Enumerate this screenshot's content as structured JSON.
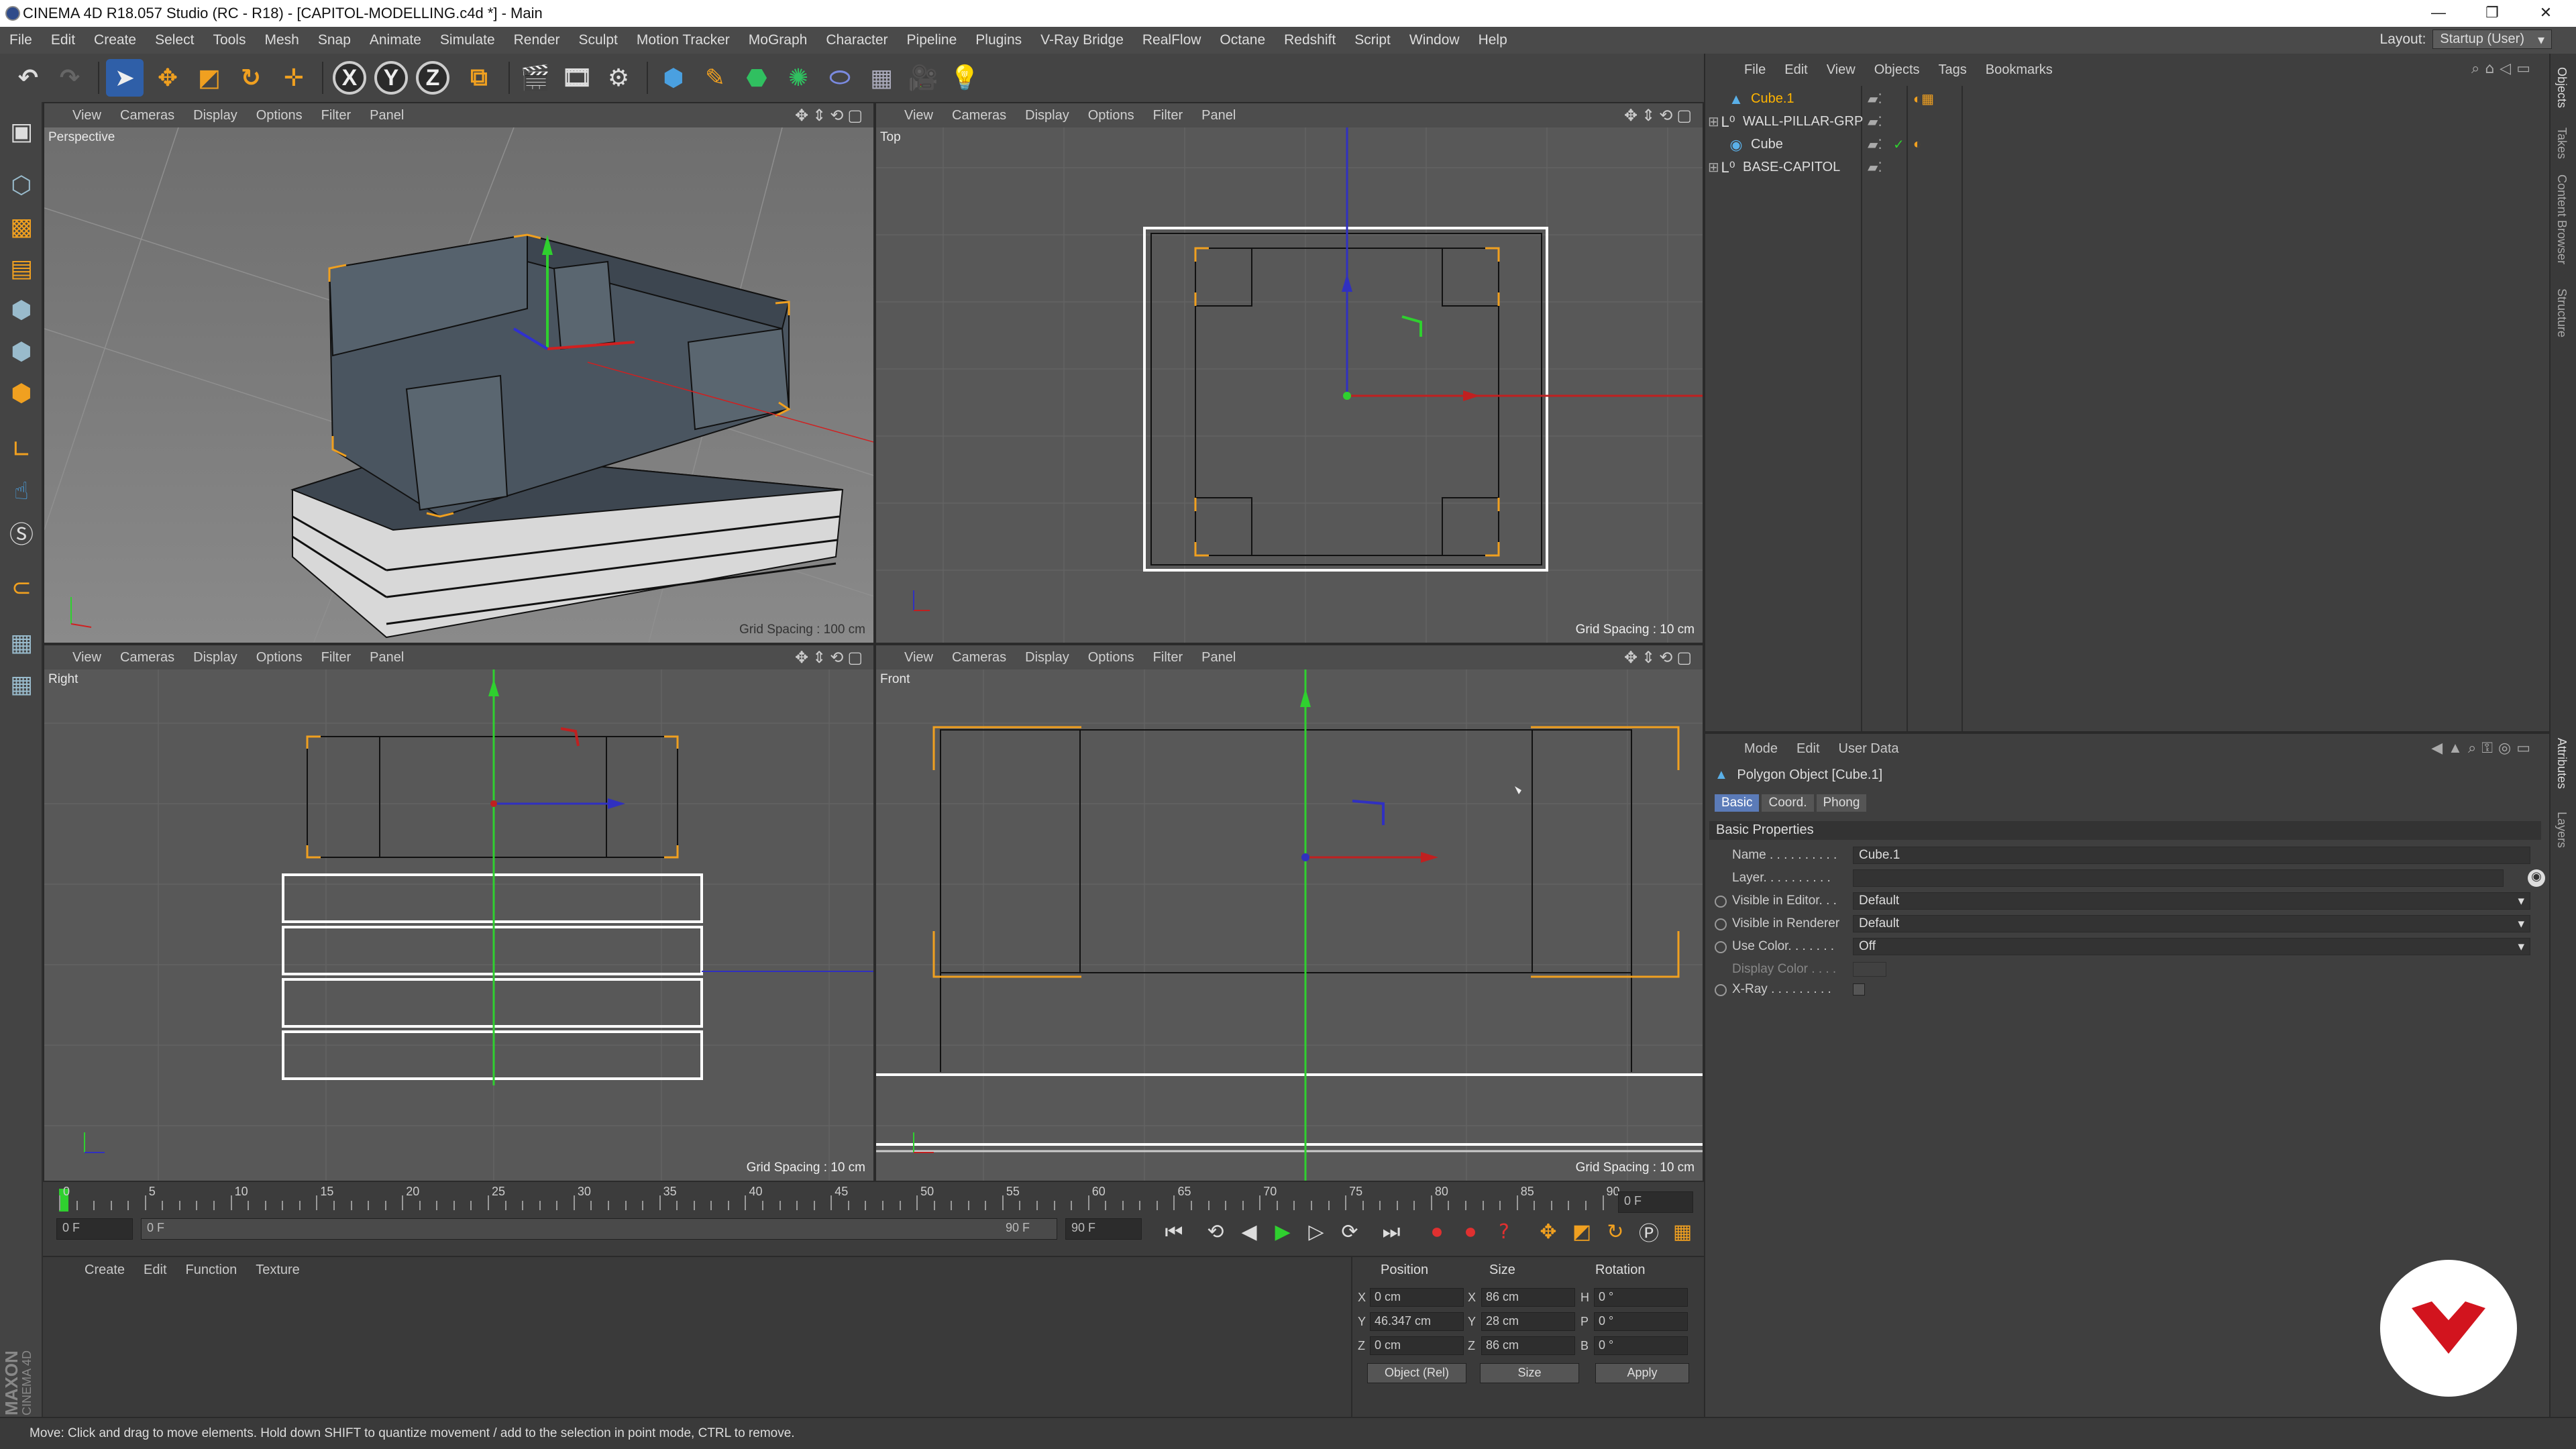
{
  "titlebar": {
    "title": "CINEMA 4D R18.057 Studio (RC - R18) - [CAPITOL-MODELLING.c4d *] - Main",
    "min": "—",
    "restore": "❐",
    "close": "✕"
  },
  "menubar": {
    "items": [
      "File",
      "Edit",
      "Create",
      "Select",
      "Tools",
      "Mesh",
      "Snap",
      "Animate",
      "Simulate",
      "Render",
      "Sculpt",
      "Motion Tracker",
      "MoGraph",
      "Character",
      "Pipeline",
      "Plugins",
      "V-Ray Bridge",
      "RealFlow",
      "Octane",
      "Redshift",
      "Script",
      "Window",
      "Help"
    ],
    "layout_label": "Layout:",
    "layout_value": "Startup (User)"
  },
  "toolbar": {
    "axis_x": "X",
    "axis_y": "Y",
    "axis_z": "Z"
  },
  "viewports": {
    "menu": [
      "View",
      "Cameras",
      "Display",
      "Options",
      "Filter",
      "Panel"
    ],
    "perspective": {
      "name": "Perspective",
      "grid": "Grid Spacing : 100 cm"
    },
    "top": {
      "name": "Top",
      "grid": "Grid Spacing : 10 cm"
    },
    "right": {
      "name": "Right",
      "grid": "Grid Spacing : 10 cm"
    },
    "front": {
      "name": "Front",
      "grid": "Grid Spacing : 10 cm"
    }
  },
  "timeline": {
    "ruler": [
      "0",
      "5",
      "10",
      "15",
      "20",
      "25",
      "30",
      "35",
      "40",
      "45",
      "50",
      "55",
      "60",
      "65",
      "70",
      "75",
      "80",
      "85",
      "90"
    ],
    "current_frame_right": "0 F",
    "start_frame": "0 F",
    "range_start": "0 F",
    "range_end": "90 F",
    "end_frame": "90 F"
  },
  "material_manager": {
    "menu": [
      "Create",
      "Edit",
      "Function",
      "Texture"
    ]
  },
  "coordinates": {
    "headers": [
      "Position",
      "Size",
      "Rotation"
    ],
    "rows": [
      {
        "axis": "X",
        "pos": "0 cm",
        "saxis": "X",
        "size": "86 cm",
        "raxis": "H",
        "rot": "0 °"
      },
      {
        "axis": "Y",
        "pos": "46.347 cm",
        "saxis": "Y",
        "size": "28 cm",
        "raxis": "P",
        "rot": "0 °"
      },
      {
        "axis": "Z",
        "pos": "0 cm",
        "saxis": "Z",
        "size": "86 cm",
        "raxis": "B",
        "rot": "0 °"
      }
    ],
    "mode": "Object (Rel)",
    "size_mode": "Size",
    "apply": "Apply"
  },
  "maxon": {
    "line1": "MAXON",
    "line2": "CINEMA 4D"
  },
  "object_manager": {
    "menu": [
      "File",
      "Edit",
      "View",
      "Objects",
      "Tags",
      "Bookmarks"
    ],
    "objects": [
      {
        "name": "Cube.1",
        "selected": true
      },
      {
        "name": "WALL-PILLAR-GRP",
        "selected": false
      },
      {
        "name": "Cube",
        "selected": false
      },
      {
        "name": "BASE-CAPITOL",
        "selected": false
      }
    ]
  },
  "attributes": {
    "menu": [
      "Mode",
      "Edit",
      "User Data"
    ],
    "object_title": "Polygon Object [Cube.1]",
    "tabs": [
      "Basic",
      "Coord.",
      "Phong"
    ],
    "section": "Basic Properties",
    "rows": [
      {
        "label": "Name . . . . . . . . . .",
        "value": "Cube.1"
      },
      {
        "label": "Layer. . . . . . . . . .",
        "value": ""
      },
      {
        "label": "Visible in Editor. . .",
        "value": "Default"
      },
      {
        "label": "Visible in Renderer",
        "value": "Default"
      },
      {
        "label": "Use Color. . . . . . .",
        "value": "Off"
      },
      {
        "label": "Display Color . . . .",
        "value": ""
      },
      {
        "label": "X-Ray . . . . . . . . .",
        "value": ""
      }
    ]
  },
  "sidetabs": [
    "Objects",
    "Takes",
    "Content Browser",
    "Structure",
    "Attributes",
    "Layers"
  ],
  "status": {
    "text": "Move: Click and drag to move elements. Hold down SHIFT to quantize movement / add to the selection in point mode, CTRL to remove."
  },
  "colors": {
    "accent": "#5b7bb8",
    "selection": "#ffb400",
    "badge_red": "#d2141e"
  }
}
